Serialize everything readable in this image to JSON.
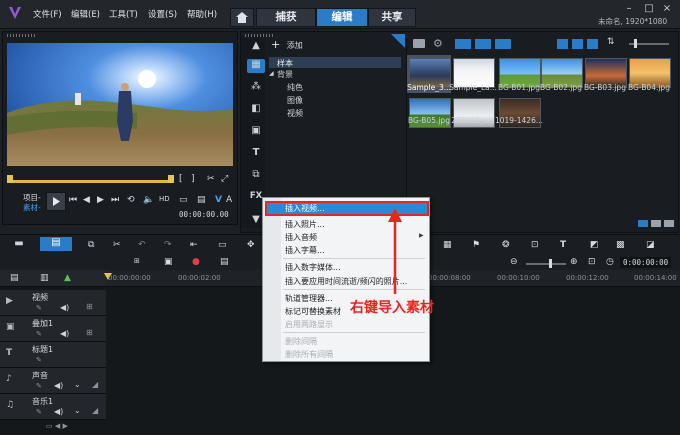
{
  "window": {
    "menus": [
      "文件(F)",
      "编辑(E)",
      "工具(T)",
      "设置(S)",
      "帮助(H)"
    ],
    "tabs": [
      {
        "label": "捕获"
      },
      {
        "label": "编辑"
      },
      {
        "label": "共享"
      }
    ],
    "project_info": "未命名, 1920*1080"
  },
  "player": {
    "mode_project": "项目-",
    "mode_clip": "素材-",
    "timecode": "00:00:00.00"
  },
  "library": {
    "add_label": "添加",
    "tree": [
      "样本",
      "背景",
      "纯色",
      "图像",
      "视频"
    ],
    "thumbnails_row1": [
      "Sample_3...",
      "Sample_La...",
      "BG-B01.jpg",
      "BG-B02.jpg",
      "BG-B03.jpg",
      "BG-B04.jpg"
    ],
    "thumbnails_row2": [
      "BG-B05.jpg",
      "275052_s...",
      "1019-1426..."
    ]
  },
  "context_menu": {
    "items": [
      {
        "label": "插入视频...",
        "enabled": true,
        "highlighted": true
      },
      {
        "label": "插入照片...",
        "enabled": true
      },
      {
        "label": "插入音频",
        "enabled": true,
        "submenu": true
      },
      {
        "label": "插入字幕...",
        "enabled": true
      },
      {
        "label": "插入数字媒体...",
        "enabled": true
      },
      {
        "label": "插入要应用时间流逝/频闪的照片...",
        "enabled": true
      },
      {
        "label": "轨道管理器...",
        "enabled": true
      },
      {
        "label": "标记可替换素材",
        "enabled": true
      },
      {
        "label": "启用两路显示",
        "enabled": false
      },
      {
        "label": "删除间隔",
        "enabled": false
      },
      {
        "label": "删除所有间隔",
        "enabled": false
      }
    ]
  },
  "annotation": {
    "text": "右键导入素材",
    "color": "#e8261f"
  },
  "timeline": {
    "timecode": "0:00:00:00",
    "ruler": [
      "00:00:00:00",
      "00:00:02:00",
      "00:00:08:00",
      "00:00:10:00",
      "00:00:12:00",
      "00:00:14:00"
    ],
    "tracks": [
      "视频",
      "叠加1",
      "标题1",
      "声音",
      "音乐1"
    ]
  },
  "colors": {
    "accent": "#2a7cc7",
    "highlight": "#2b8ad8",
    "annotation": "#e8261f"
  }
}
